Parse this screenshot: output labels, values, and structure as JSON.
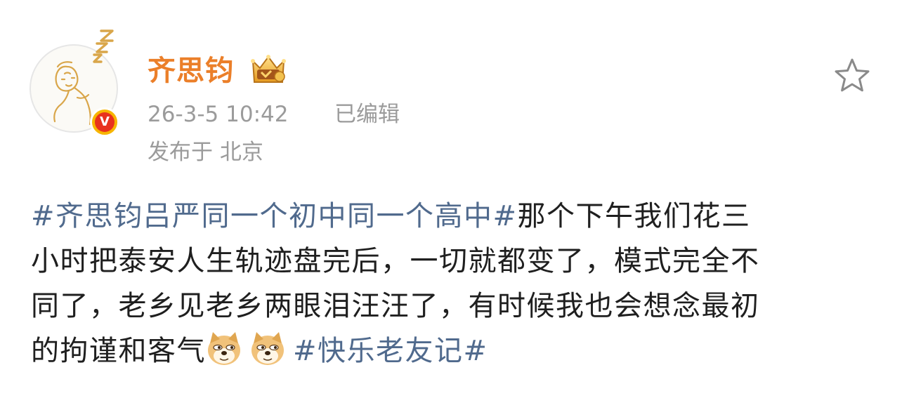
{
  "author": {
    "name": "齐思钧",
    "avatar_icon": "sleeping-cartoon-avatar",
    "verified_icon": "verified-v-badge",
    "verified_label": "V",
    "vip_icon": "vip-crown-icon"
  },
  "meta": {
    "timestamp": "26-3-5 10:42",
    "edited_label": "已编辑",
    "location_label": "发布于 北京"
  },
  "actions": {
    "favorite_icon": "star-outline-icon"
  },
  "post": {
    "topic_1": "#齐思钧吕严同一个初中同一个高中#",
    "line1_text": "那个下午我们花三",
    "line2_text": "小时把泰安人生轨迹盘完后，一切就都变了，模式完全不",
    "line3_text": "同了，老乡见老乡两眼泪汪汪了，有时候我也会想念最初",
    "line4_text": "的拘谨和客气",
    "emojis": [
      "doge-emoji",
      "doge-emoji"
    ],
    "topic_2": "#快乐老友记#"
  },
  "colors": {
    "username": "#eb7f29",
    "topic_link": "#506a8d",
    "meta_gray": "#9b9b9b",
    "body_text": "#1f1f1f"
  }
}
